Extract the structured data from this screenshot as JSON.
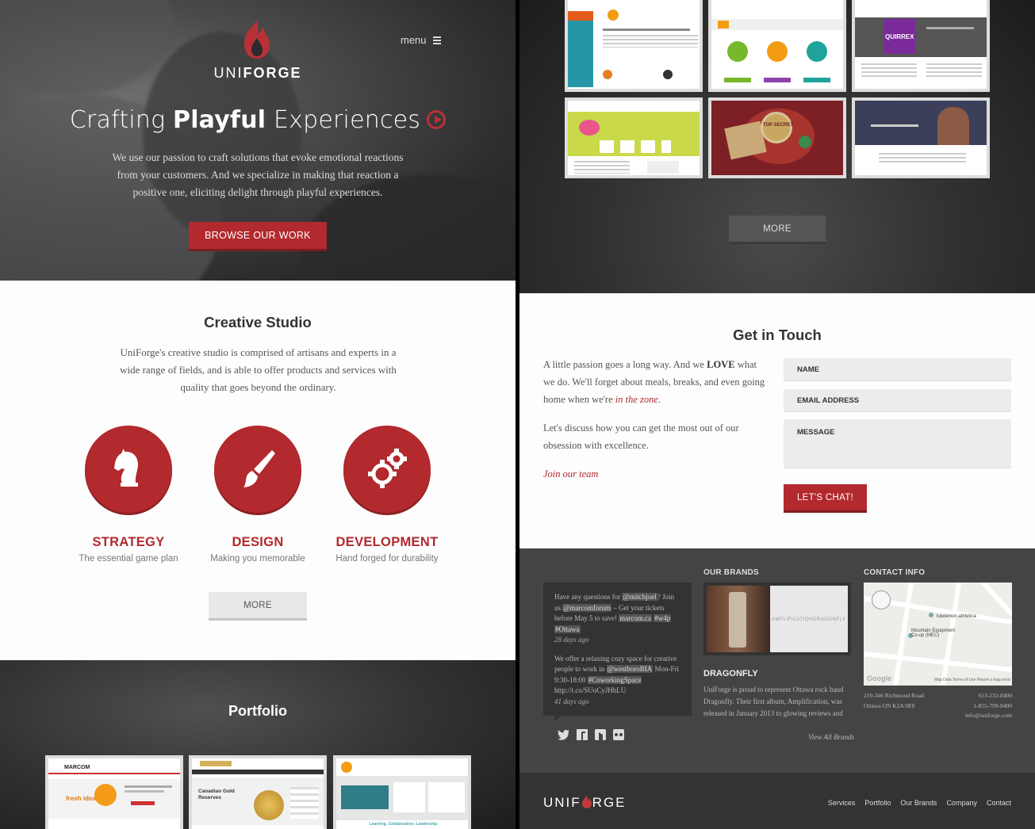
{
  "hero": {
    "logo_prefix": "UNI",
    "logo_suffix": "FORGE",
    "menu_label": "menu",
    "title_pre": "Crafting ",
    "title_bold": "Playful",
    "title_post": " Experiences",
    "text": "We use our passion to craft solutions that evoke emotional reactions from your customers. And we specialize in making that reaction a positive one, eliciting delight through playful experiences.",
    "browse_label": "BROWSE OUR WORK"
  },
  "studio": {
    "title": "Creative Studio",
    "text": "UniForge's creative studio is comprised of artisans and experts in a wide range of fields, and is able to offer products and services with quality that goes beyond the ordinary.",
    "services": [
      {
        "title": "STRATEGY",
        "sub": "The essential game plan",
        "icon": "chess-knight-icon"
      },
      {
        "title": "DESIGN",
        "sub": "Making you memorable",
        "icon": "paintbrush-icon"
      },
      {
        "title": "DEVELOPMENT",
        "sub": "Hand forged for durability",
        "icon": "gears-icon"
      }
    ],
    "more_label": "MORE"
  },
  "portfolio": {
    "title": "Portfolio",
    "more_label": "MORE",
    "thumb_texts": {
      "marcom_logo": "MARCOM",
      "fresh_ideas": "fresh ideas",
      "gold_heading": "Canadian Gold Reserves",
      "learning": "Learning. Collaboration. Leadership.",
      "quirrex": "QUIRREX",
      "top_secret": "TOP SECRET"
    }
  },
  "touch": {
    "title": "Get in Touch",
    "p1_a": "A little passion goes a long way. And we ",
    "p1_b": "LOVE",
    "p1_c": " what we do. We'll forget about meals, breaks, and even going home when we're ",
    "p1_d": "in the zone",
    "p1_e": ".",
    "p2": "Let's discuss how you can get the most out of our obsession with excellence.",
    "join": "Join our team",
    "name_ph": "NAME",
    "email_ph": "EMAIL ADDRESS",
    "message_ph": "MESSAGE",
    "chat_label": "LET'S CHAT!"
  },
  "footer": {
    "tweet1_a": "Have any questions for ",
    "tweet1_h1": "@mitchjoel",
    "tweet1_b": "? Join us ",
    "tweet1_h2": "@marcomforum",
    "tweet1_c": " – Get your tickets before May 5 to save! ",
    "tweet1_h3": "marcom.ca",
    "tweet1_d": " ",
    "tweet1_h4": "#w4p",
    "tweet1_h5": "#Ottawa",
    "tweet1_ago": "28 days ago",
    "tweet2_a": "We offer a relaxing cozy space for creative people to work in ",
    "tweet2_h1": "@westboroBIA",
    "tweet2_b": " Mon-Fri 9:30-18:00 ",
    "tweet2_h2": "#CoworkingSpace",
    "tweet2_c": " http://t.co/SUoCyJHhLU",
    "tweet2_ago": "41 days ago",
    "brands_title": "OUR BRANDS",
    "brand_img_text": "AMPLIFICATIONDRAGONFLY",
    "brand_name": "DRAGONFLY",
    "brand_desc": "UniForge is proud to represent Ottawa rock band Dragonfly. Their first album, Amplification, was released in January 2013 to glowing reviews and",
    "view_all": "View All Brands",
    "contact_title": "CONTACT INFO",
    "map_label1": "lululemon athletica",
    "map_label2": "Mountain Equipment Co-op (MEC)",
    "map_google": "Google",
    "map_credits": "Map Data  Terms of Use  Report a map error",
    "addr1": "210-346 Richmond Road",
    "addr2": "Ottawa ON K2A 0E8",
    "phone1": "613-232-8400",
    "phone2": "1-855-799-8400",
    "email": "info@uniforge.com",
    "nav": [
      "Services",
      "Portfolio",
      "Our Brands",
      "Company",
      "Contact"
    ],
    "logo_a": "UNIF",
    "logo_b": "RGE"
  },
  "colors": {
    "accent": "#b2292e",
    "dark": "#333333",
    "footer": "#444444"
  }
}
